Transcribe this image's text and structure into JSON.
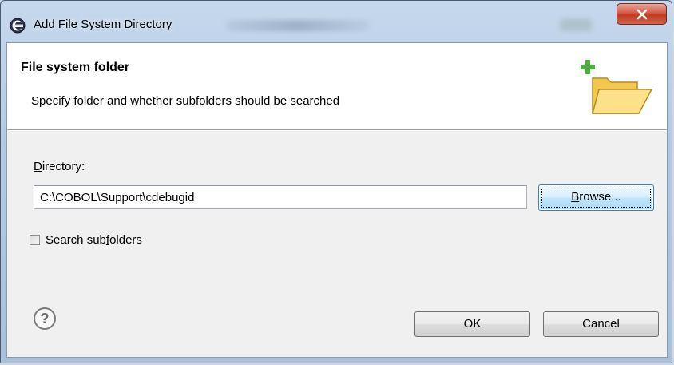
{
  "window": {
    "title": "Add File System Directory",
    "close_icon": "close-x-icon",
    "app_icon": "eclipse-icon"
  },
  "banner": {
    "title": "File system folder",
    "description": "Specify folder and whether subfolders should be searched",
    "icon": "new-folder-icon"
  },
  "form": {
    "directory_label_pre": "",
    "directory_label_mnemonic": "D",
    "directory_label_post": "irectory:",
    "directory_value": "C:\\COBOL\\Support\\cdebugid",
    "browse_mnemonic": "B",
    "browse_rest": "rowse...",
    "search_subfolders_pre": "Search sub",
    "search_subfolders_mnemonic": "f",
    "search_subfolders_post": "olders",
    "search_subfolders_checked": false
  },
  "footer": {
    "help_icon": "help-icon",
    "ok_label": "OK",
    "cancel_label": "Cancel"
  },
  "colors": {
    "close_button": "#c23a24",
    "focus_button": "#3c7fb1",
    "dialog_bg": "#f0f0f0"
  }
}
